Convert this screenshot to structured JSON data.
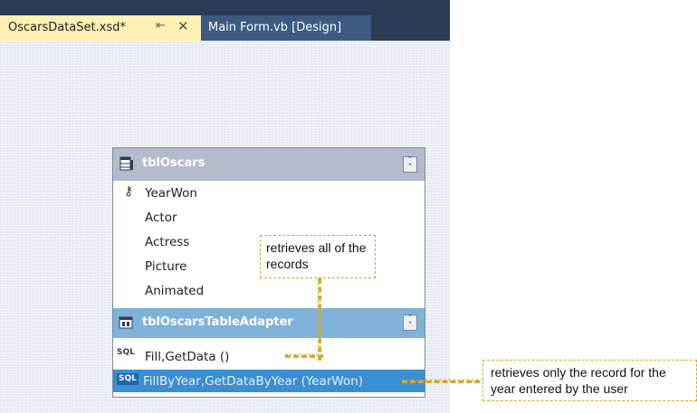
{
  "tabs": {
    "active": {
      "label": "OscarsDataSet.xsd*",
      "pin_icon": "pin-icon",
      "close_icon": "close-icon"
    },
    "inactive": {
      "label": "Main Form.vb [Design]"
    }
  },
  "table": {
    "title": "tblOscars",
    "icon": "table-icon",
    "columns": [
      "YearWon",
      "Actor",
      "Actress",
      "Picture",
      "Animated"
    ],
    "primary_key": "YearWon"
  },
  "adapter": {
    "title": "tblOscarsTableAdapter",
    "icon": "table-adapter-icon",
    "queries": [
      {
        "icon_label": "SQL",
        "name": "Fill,GetData ()"
      },
      {
        "icon_label": "SQL",
        "name": "FillByYear,GetDataByYear (YearWon)",
        "selected": true
      }
    ]
  },
  "callouts": {
    "fill_all": "retrieves all of the records",
    "fill_by_year": "retrieves only the record for the year entered by the user"
  },
  "colors": {
    "tab_active": "#fff0b3",
    "tabstrip": "#2b3c57",
    "selected_query": "#3a8fd2",
    "callout_border": "#d3a92a"
  }
}
